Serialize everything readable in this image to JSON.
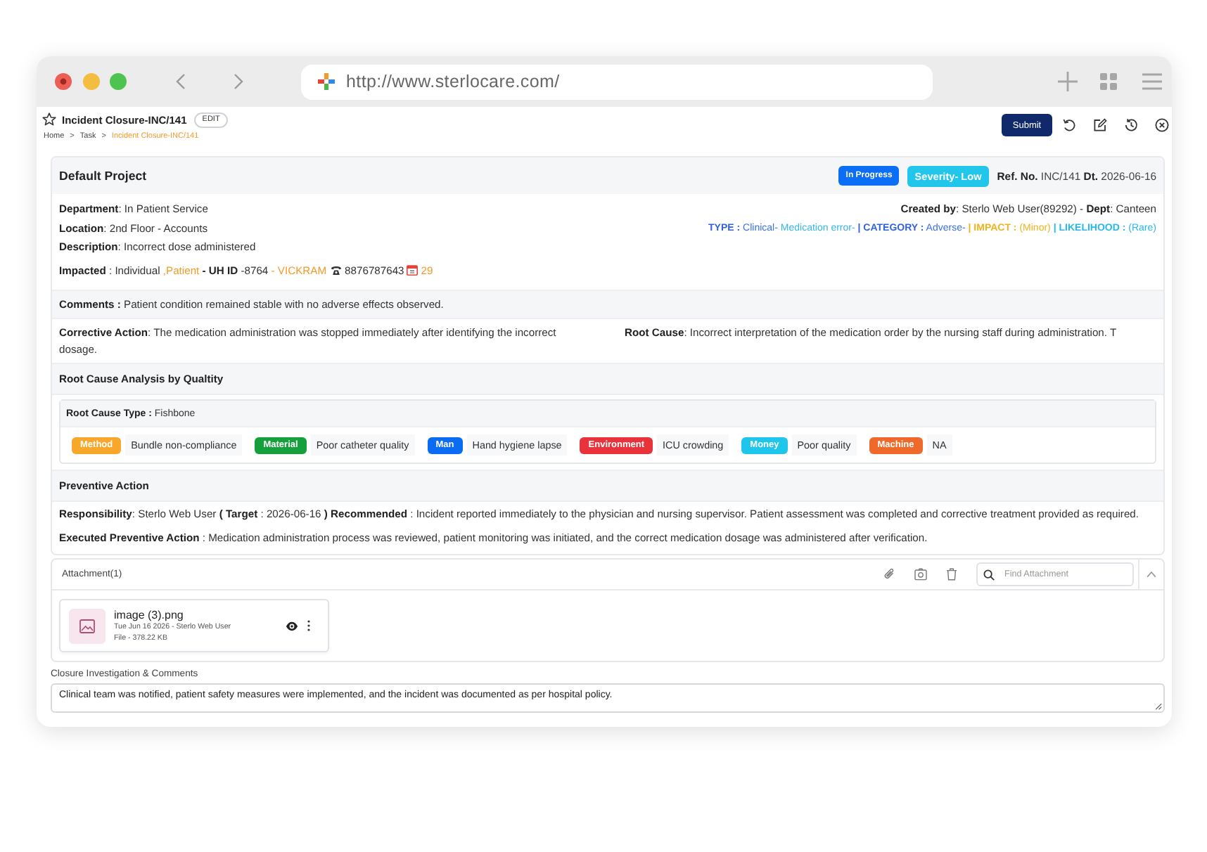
{
  "browser": {
    "url": "http://www.sterlocare.com/"
  },
  "page": {
    "title": "Incident Closure-INC/141",
    "edit_label": "EDIT",
    "breadcrumb": [
      {
        "label": "Home",
        "current": false
      },
      {
        "separator": ">",
        "label": "Task",
        "current": false
      },
      {
        "separator": ">",
        "label": "Incident Closure-INC/141",
        "current": true
      }
    ],
    "submit_label": "Submit"
  },
  "project": {
    "name": "Default Project",
    "status": "In Progress",
    "severity": "Severity- Low",
    "reference": "**Ref. No.** INC/141 **Dt.** 2026-06-16",
    "details": [
      "**Department**: In Patient Service",
      "**Location**: 2nd Floor - Accounts",
      "**Description**: Incorrect dose administered"
    ],
    "impacted": {
      "parts": [
        {
          "kind": "label",
          "text": "Impacted"
        },
        {
          "kind": "plain",
          "text": ": Individual"
        },
        {
          "kind": "accent",
          "text": ",Patient"
        },
        {
          "kind": "label",
          "text": "- UH ID"
        },
        {
          "kind": "plain",
          "text": "-8764"
        },
        {
          "kind": "accent",
          "text": "- VICKRAM"
        }
      ],
      "phone": "8876787643",
      "calendar_value": "29"
    },
    "created_by": "**Created by**: Sterlo Web User(89292) - **Dept**: Canteen",
    "classification": [
      {
        "kind": "label",
        "text": "TYPE :",
        "color": "#2f62e0"
      },
      {
        "kind": "value",
        "text": "Clinical-",
        "color": "#3a6fe6"
      },
      {
        "kind": "value",
        "text": "Medication error-",
        "color": "#35b4ee"
      },
      {
        "kind": "label",
        "text": "| CATEGORY :",
        "color": "#2f62e0"
      },
      {
        "kind": "value",
        "text": "Adverse-",
        "color": "#3a6fe6"
      },
      {
        "kind": "label",
        "text": "| IMPACT :",
        "color": "#f3b21d"
      },
      {
        "kind": "value",
        "text": "(Minor)",
        "color": "#f3b21d"
      },
      {
        "kind": "label",
        "text": "| LIKELIHOOD :",
        "color": "#27b8ec"
      },
      {
        "kind": "value",
        "text": "(Rare)",
        "color": "#27b8ec"
      }
    ],
    "comments": "**Comments :** Patient condition remained stable with no adverse effects observed.",
    "corrective_action": "**Corrective Action**: The medication administration was stopped immediately after identifying the incorrect dosage.",
    "root_cause": "**Root Cause**: Incorrect interpretation of the medication order by the nursing staff during administration. T",
    "rca": {
      "title": "Root Cause Analysis by Qualtity",
      "type_line": "**Root Cause Type :** Fishbone",
      "causes": [
        {
          "category": "Method",
          "color": "#f8a72a",
          "cause": "Bundle non-compliance"
        },
        {
          "category": "Material",
          "color": "#16a03c",
          "cause": "Poor catheter quality"
        },
        {
          "category": "Man",
          "color": "#0a6cf2",
          "cause": "Hand hygiene lapse"
        },
        {
          "category": "Environment",
          "color": "#e8333b",
          "cause": "ICU crowding"
        },
        {
          "category": "Money",
          "color": "#1fc6ec",
          "cause": "Poor quality"
        },
        {
          "category": "Machine",
          "color": "#ef6a2a",
          "cause": "NA"
        }
      ]
    },
    "preventive": {
      "title": "Preventive Action",
      "responsibility": "**Responsibility**: Sterlo Web User **( Target** : 2026-06-16 **) Recommended** : Incident reported immediately to the physician and nursing supervisor. Patient assessment was completed and corrective treatment provided as required.",
      "executed": "**Executed Preventive Action** : Medication administration process was reviewed, patient monitoring was initiated, and the correct medication dosage was administered after verification."
    }
  },
  "attachments": {
    "title": "Attachment(1)",
    "search": {
      "placeholder": "Find Attachment"
    },
    "files": [
      {
        "name": "image (3).png",
        "meta": "Tue Jun 16 2026 - Sterlo Web User",
        "size": "File - 378.22 KB"
      }
    ]
  },
  "closure": {
    "label": "Closure Investigation & Comments",
    "value": "Clinical team was notified, patient safety measures were implemented, and the incident was documented as per hospital policy."
  }
}
